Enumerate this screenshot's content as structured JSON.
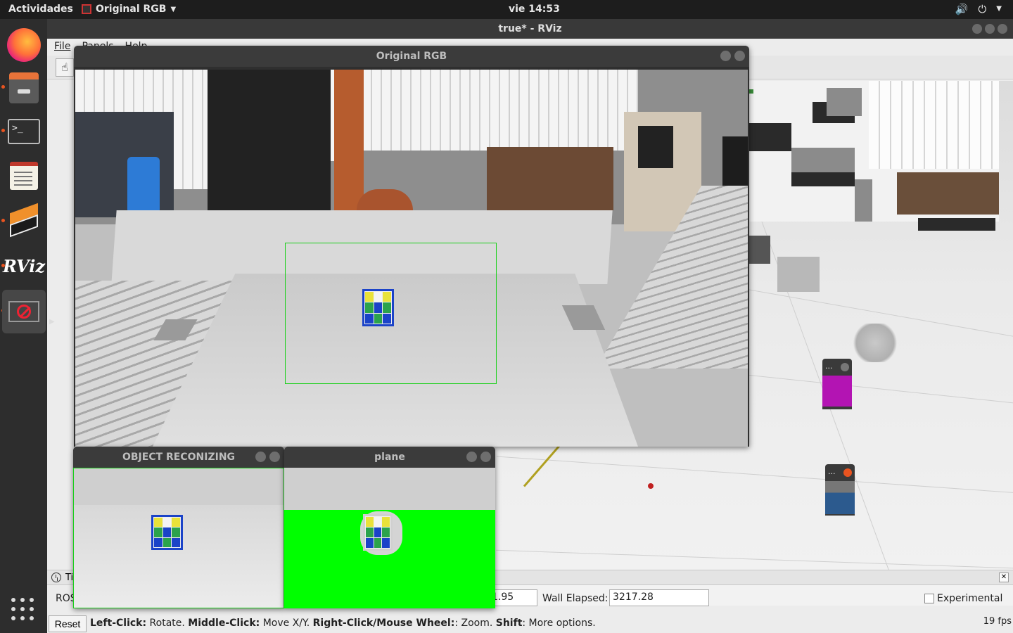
{
  "topbar": {
    "activities": "Actividades",
    "app_name": "Original RGB",
    "clock": "vie 14:53"
  },
  "dock": {
    "apps": [
      "firefox-icon",
      "files-icon",
      "terminal-icon",
      "text-editor-icon",
      "stack-icon",
      "rviz-icon",
      "stop-icon"
    ],
    "terminal_glyph": ">_",
    "rviz_label": "RViz"
  },
  "rviz": {
    "window_title": "true* - RViz",
    "menu": [
      "File",
      "Panels",
      "Help"
    ]
  },
  "windows": {
    "original_rgb": "Original RGB",
    "object_reconizing": "OBJECT RECONIZING",
    "plane": "plane"
  },
  "mini_windows": {
    "dots": "..."
  },
  "time_panel": {
    "header": "Ti",
    "ros_label": "ROS",
    "ros_elapsed_partial": "1.95",
    "wall_elapsed_label": "Wall Elapsed:",
    "wall_elapsed_value": "3217.28",
    "experimental_label": "Experimental"
  },
  "status": {
    "reset": "Reset",
    "left_click": "Left-Click:",
    "left_action": " Rotate. ",
    "middle_click": "Middle-Click:",
    "middle_action": " Move X/Y. ",
    "right_click": "Right-Click/Mouse Wheel:",
    "right_action": ": Zoom. ",
    "shift": "Shift",
    "shift_action": ": More options.",
    "fps": "19 fps"
  },
  "colors": {
    "detection_box": "#18d018",
    "cube_outline": "#1b43c8",
    "plane_mask": "#00ff00",
    "accent": "#e95420"
  }
}
